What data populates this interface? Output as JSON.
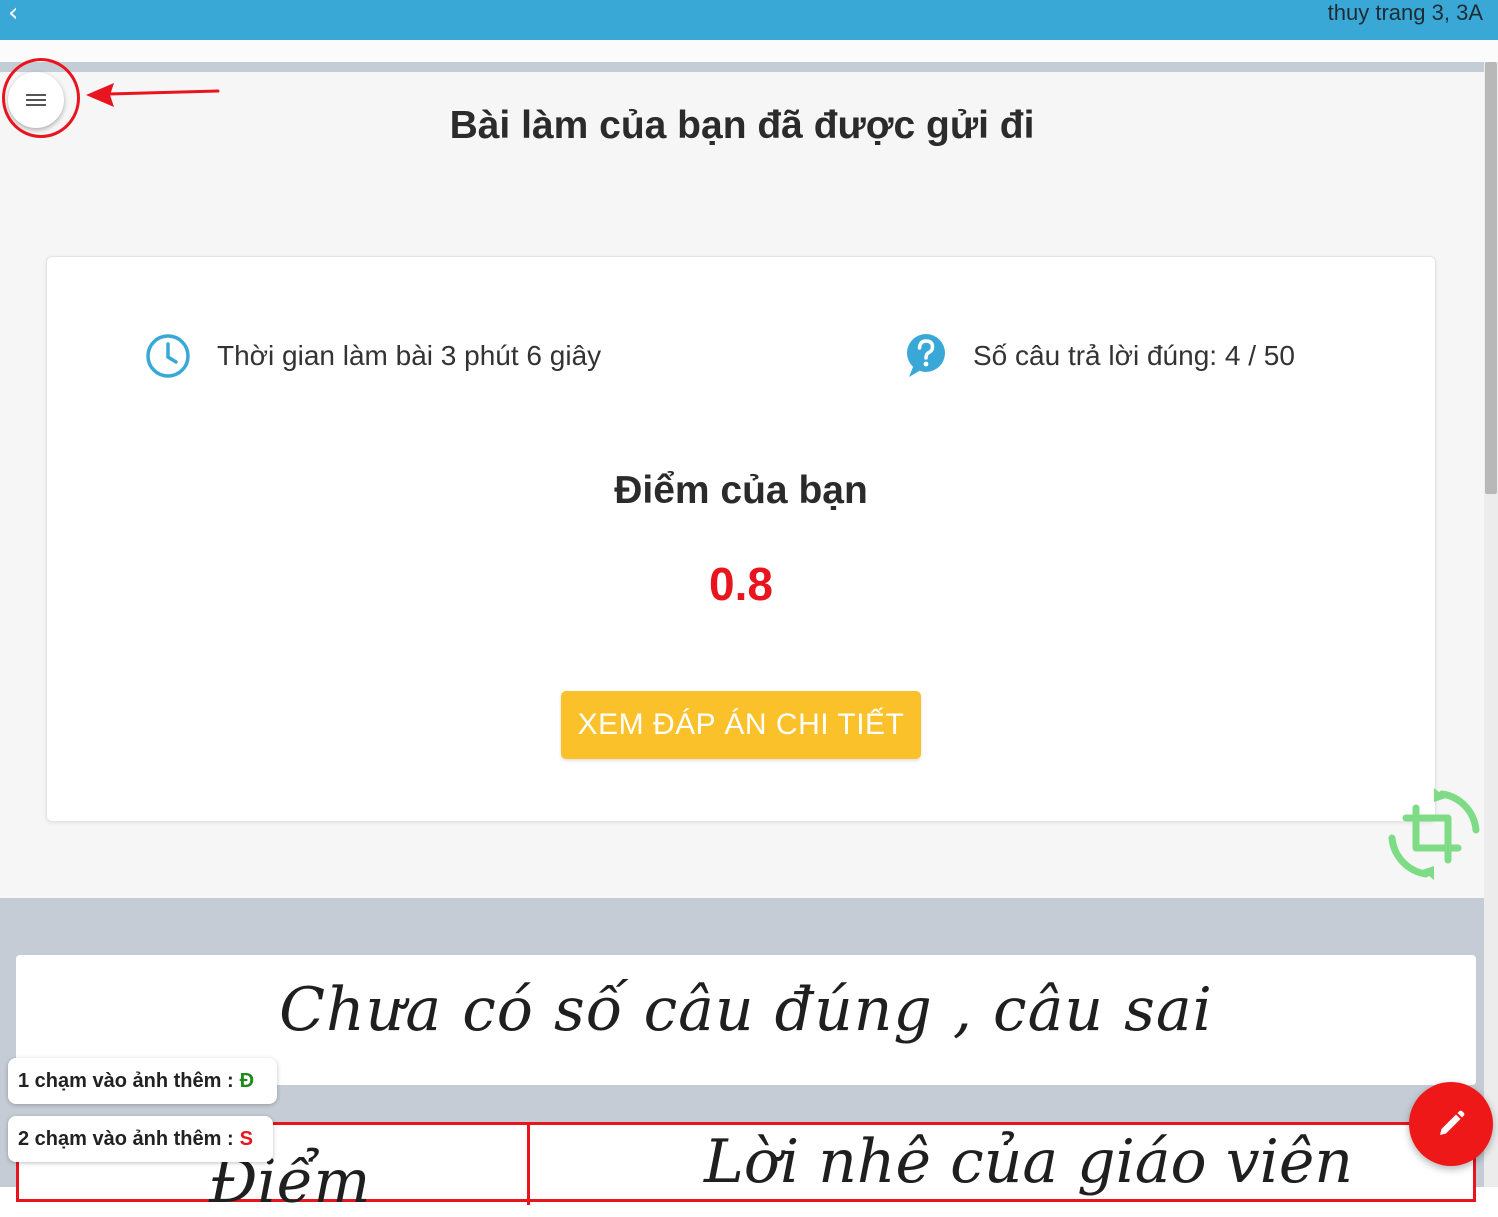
{
  "header": {
    "back_icon": "chevron-left-icon",
    "user_label": "thuy trang 3, 3A"
  },
  "menu": {
    "icon": "hamburger-icon"
  },
  "page": {
    "title": "Bài làm của bạn đã được gửi đi"
  },
  "result": {
    "time_label": "Thời gian làm bài 3 phút 6 giây",
    "correct_label": "Số câu trả lời đúng: 4 / 50",
    "score_label": "Điểm của bạn",
    "score_value": "0.8",
    "detail_button": "XEM ĐÁP ÁN CHI TIẾT"
  },
  "worksheet": {
    "status_text": "Chưa có số câu đúng , câu sai",
    "col_left": "Điểm",
    "col_right": "Lời nhê của giáo viên"
  },
  "tips": [
    {
      "text": "1 chạm vào ảnh thêm :",
      "mark": "Đ"
    },
    {
      "text": "2 chạm vào ảnh thêm :",
      "mark": "S"
    }
  ],
  "colors": {
    "header_blue": "#3aa8d6",
    "score_red": "#e8141e",
    "button_yellow": "#fbc12a",
    "fab_red": "#ef1818",
    "mark_correct": "#1e8a1e"
  }
}
